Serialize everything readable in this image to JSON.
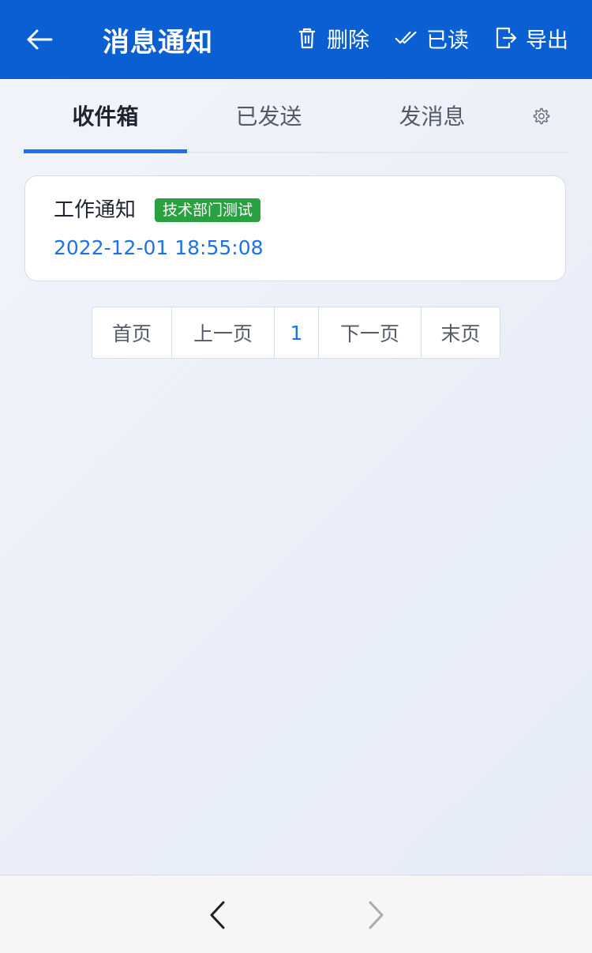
{
  "header": {
    "title": "消息通知",
    "back_icon": "arrow-left-icon",
    "actions": {
      "delete": {
        "label": "删除",
        "icon": "trash-icon"
      },
      "read": {
        "label": "已读",
        "icon": "double-check-icon"
      },
      "export": {
        "label": "导出",
        "icon": "export-icon"
      }
    }
  },
  "tabs": {
    "inbox": "收件箱",
    "sent": "已发送",
    "compose": "发消息",
    "active": "inbox",
    "settings_icon": "gear-icon"
  },
  "messages": [
    {
      "title": "工作通知",
      "badge": "技术部门测试",
      "time": "2022-12-01 18:55:08"
    }
  ],
  "pagination": {
    "first": "首页",
    "prev": "上一页",
    "current": "1",
    "next": "下一页",
    "last": "末页"
  },
  "bottom_nav": {
    "back_icon": "chevron-left-icon",
    "forward_icon": "chevron-right-icon"
  },
  "colors": {
    "header_bg": "#0a5fd3",
    "accent": "#1a73e8",
    "badge_bg": "#2aa140"
  }
}
